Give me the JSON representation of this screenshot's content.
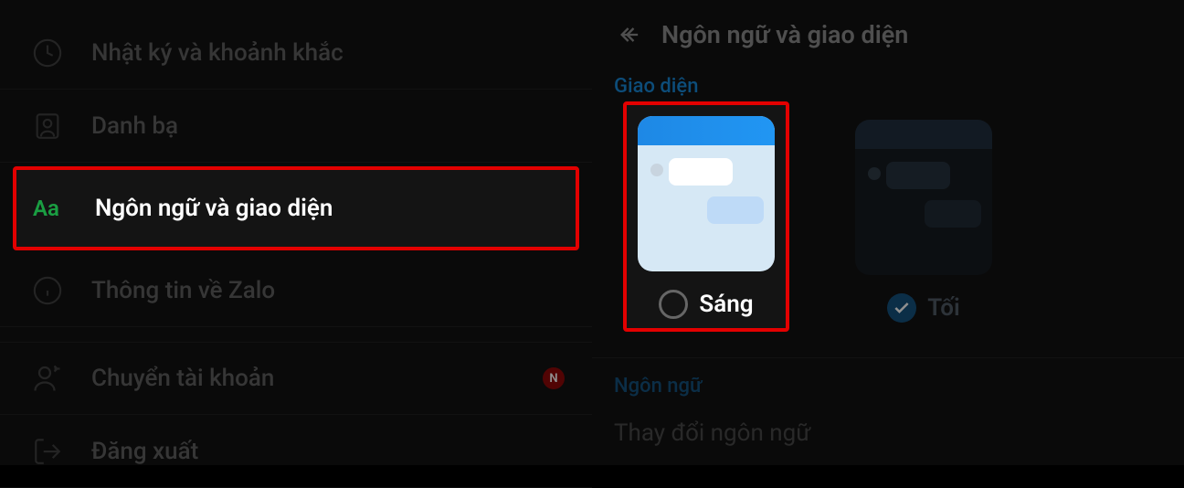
{
  "left": {
    "items": [
      {
        "key": "diary",
        "label": "Nhật ký và khoảnh khắc",
        "icon": "clock"
      },
      {
        "key": "contacts",
        "label": "Danh bạ",
        "icon": "contact"
      },
      {
        "key": "language",
        "label": "Ngôn ngữ và giao diện",
        "icon": "aa",
        "selected": true
      },
      {
        "key": "about",
        "label": "Thông tin về Zalo",
        "icon": "info"
      },
      {
        "key": "switch",
        "label": "Chuyển tài khoản",
        "icon": "switch",
        "badge": "N"
      },
      {
        "key": "logout",
        "label": "Đăng xuất",
        "icon": "logout"
      }
    ]
  },
  "right": {
    "title": "Ngôn ngữ và giao diện",
    "section_theme": "Giao diện",
    "themes": {
      "light": {
        "label": "Sáng",
        "selected": false,
        "highlighted": true
      },
      "dark": {
        "label": "Tối",
        "selected": true,
        "highlighted": false
      }
    },
    "section_language": "Ngôn ngữ",
    "language_change": "Thay đổi ngôn ngữ"
  }
}
